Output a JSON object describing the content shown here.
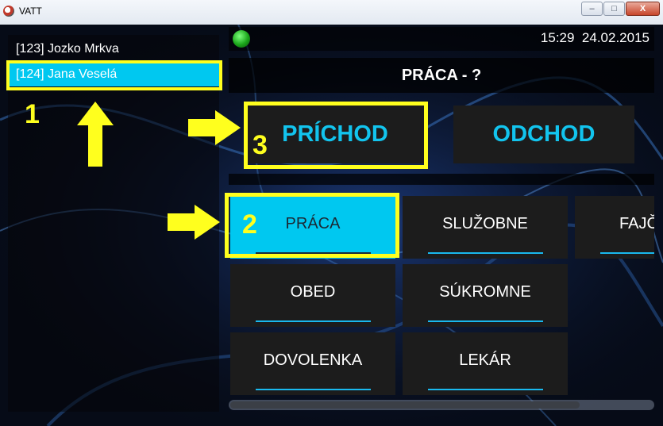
{
  "window": {
    "title": "VATT",
    "minimize": "–",
    "maximize": "□",
    "close": "X"
  },
  "employees": [
    {
      "label": "[123] Jozko Mrkva",
      "selected": false
    },
    {
      "label": "[124] Jana Veselá",
      "selected": true
    }
  ],
  "status": {
    "time": "15:29",
    "date": "24.02.2015",
    "indicator": "green"
  },
  "header": {
    "title": "PRÁCA - ?"
  },
  "actions": {
    "arrival": "PRÍCHOD",
    "departure": "ODCHOD"
  },
  "types": [
    {
      "label": "PRÁCA",
      "selected": true
    },
    {
      "label": "SLUŽOBNE"
    },
    {
      "label": "FAJČ"
    },
    {
      "label": "OBED"
    },
    {
      "label": "SÚKROMNE"
    },
    {
      "label": "DOVOLENKA"
    },
    {
      "label": "LEKÁR"
    }
  ],
  "annotations": {
    "step1": "1",
    "step2": "2",
    "step3": "3"
  },
  "colors": {
    "accent": "#00c8f0",
    "highlight": "#ffff1e",
    "button": "#1c1c1c"
  }
}
